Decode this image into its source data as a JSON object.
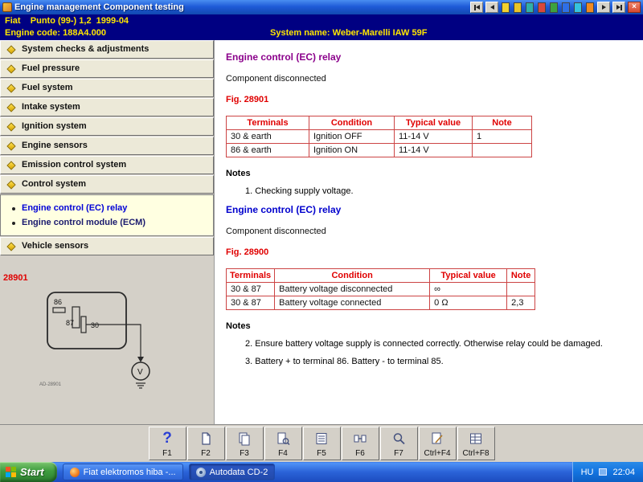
{
  "title_bar": {
    "app_icon": "engine-icon",
    "title": "Engine management Component testing",
    "nav_icons": [
      "nav-first",
      "nav-prev",
      "doc-yellow",
      "doc-gold",
      "doc-teal",
      "doc-red",
      "doc-green",
      "doc-blue",
      "doc-cyan",
      "doc-orange",
      "nav-next",
      "nav-last"
    ],
    "close_label": "×"
  },
  "header": {
    "vehicle_make_model": "Fiat    Punto (99-) 1,2  1999-04",
    "engine_code": "Engine code: 188A4.000",
    "system_name": "System name: Weber-Marelli IAW 59F"
  },
  "colors": {
    "header_bg": "#000082",
    "highlight_yellow": "#FFE600",
    "table_border_red": "#CC4444",
    "fig_red": "#E00000",
    "heading_purple": "#8B008B",
    "link_blue": "#0000CD",
    "start_green": "#3F9D3F",
    "taskbar_blue": "#2B63D8"
  },
  "sidebar": {
    "items": [
      {
        "label": "System checks & adjustments"
      },
      {
        "label": "Fuel pressure"
      },
      {
        "label": "Fuel system"
      },
      {
        "label": "Intake system"
      },
      {
        "label": "Ignition system"
      },
      {
        "label": "Engine sensors"
      },
      {
        "label": "Emission control system"
      },
      {
        "label": "Control system"
      },
      {
        "label": "Vehicle sensors"
      }
    ],
    "submenu": [
      {
        "label": "Engine control (EC) relay",
        "selected": true
      },
      {
        "label": "Engine control module (ECM)",
        "selected": false
      }
    ],
    "figure_number": "28901",
    "diagram": {
      "pin_labels": [
        "86",
        "87",
        "30"
      ],
      "meter_label": "V",
      "caption": "AD-28901"
    }
  },
  "content": {
    "section1": {
      "title": "Engine control (EC) relay",
      "subtitle": "Component disconnected",
      "fig": "Fig. 28901",
      "table": {
        "headers": [
          "Terminals",
          "Condition",
          "Typical value",
          "Note"
        ],
        "rows": [
          [
            "30 & earth",
            "Ignition OFF",
            "11-14 V",
            "1"
          ],
          [
            "86 & earth",
            "Ignition ON",
            "11-14 V",
            ""
          ]
        ]
      },
      "notes_title": "Notes",
      "notes": [
        "1. Checking supply voltage."
      ]
    },
    "section2": {
      "title": "Engine control (EC) relay",
      "subtitle": "Component disconnected",
      "fig": "Fig. 28900",
      "table": {
        "headers": [
          "Terminals",
          "Condition",
          "Typical value",
          "Note"
        ],
        "rows": [
          [
            "30 & 87",
            "Battery voltage disconnected",
            "∞",
            ""
          ],
          [
            "30 & 87",
            "Battery voltage connected",
            "0 Ω",
            "2,3"
          ]
        ]
      },
      "notes_title": "Notes",
      "notes": [
        "2. Ensure battery voltage supply is connected correctly. Otherwise relay could be damaged.",
        "3. Battery + to terminal 86. Battery - to terminal 85."
      ]
    }
  },
  "toolbar": {
    "buttons": [
      {
        "label": "F1",
        "icon": "help-icon",
        "glyph": "?"
      },
      {
        "label": "F2",
        "icon": "document-icon"
      },
      {
        "label": "F3",
        "icon": "documents-icon"
      },
      {
        "label": "F4",
        "icon": "document-search-icon"
      },
      {
        "label": "F5",
        "icon": "list-icon"
      },
      {
        "label": "F6",
        "icon": "component-icon"
      },
      {
        "label": "F7",
        "icon": "probe-icon"
      },
      {
        "label": "Ctrl+F4",
        "icon": "page-icon"
      },
      {
        "label": "Ctrl+F8",
        "icon": "grid-icon"
      }
    ]
  },
  "taskbar": {
    "start_label": "Start",
    "tasks": [
      {
        "label": "Fiat elektromos hiba -...",
        "icon": "firefox-icon",
        "active": false
      },
      {
        "label": "Autodata CD-2",
        "icon": "cd-icon",
        "active": true
      }
    ],
    "tray": {
      "language": "HU",
      "time": "22:04"
    }
  }
}
